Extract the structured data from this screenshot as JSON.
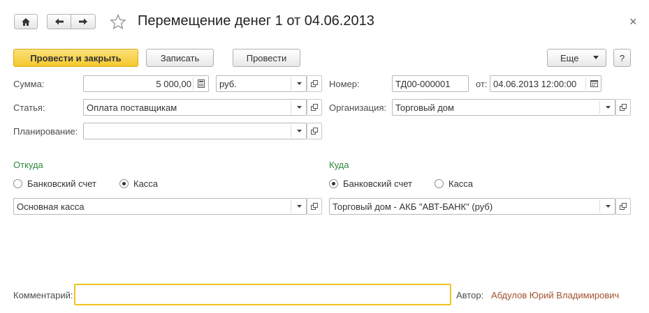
{
  "header": {
    "title": "Перемещение денег 1 от 04.06.2013",
    "close_symbol": "×"
  },
  "toolbar": {
    "post_close_label": "Провести и закрыть",
    "save_label": "Записать",
    "post_label": "Провести",
    "more_label": "Еще",
    "help_label": "?"
  },
  "form": {
    "amount_label": "Сумма:",
    "amount_value": "5 000,00",
    "currency_value": "руб.",
    "number_label": "Номер:",
    "number_value": "ТД00-000001",
    "date_label": "от:",
    "date_value": "04.06.2013 12:00:00",
    "article_label": "Статья:",
    "article_value": "Оплата поставщикам",
    "organization_label": "Организация:",
    "organization_value": "Торговый дом",
    "planning_label": "Планирование:",
    "planning_value": ""
  },
  "from": {
    "title": "Откуда",
    "option_bank": "Банковский счет",
    "option_cash": "Касса",
    "selected": "cash",
    "value": "Основная касса"
  },
  "to": {
    "title": "Куда",
    "option_bank": "Банковский счет",
    "option_cash": "Касса",
    "selected": "bank",
    "value": "Торговый дом - АКБ \"АВТ-БАНК\" (руб)"
  },
  "footer": {
    "comment_label": "Комментарий:",
    "comment_value": "",
    "author_label": "Автор:",
    "author_value": "Абдулов Юрий Владимирович"
  },
  "colors": {
    "primary_button": "#f4c82c",
    "section_title": "#2d8a3e",
    "author_link": "#a0522d",
    "comment_focus": "#f2c31f"
  },
  "icons": [
    "home-icon",
    "back-arrow-icon",
    "forward-arrow-icon",
    "star-icon",
    "close-icon",
    "dropdown-arrow-icon",
    "calculator-icon",
    "calendar-icon",
    "open-icon"
  ]
}
